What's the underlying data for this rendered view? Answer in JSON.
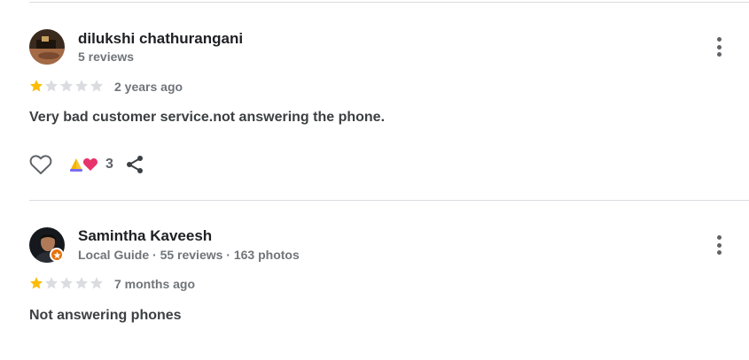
{
  "reviews": [
    {
      "reviewer_name": "dilukshi chathurangani",
      "reviewer_meta": "5 reviews",
      "rating": 1,
      "max_rating": 5,
      "time_ago": "2 years ago",
      "text": "Very bad customer service.not answering the phone.",
      "reaction_count": "3",
      "local_guide": false
    },
    {
      "reviewer_name": "Samintha Kaveesh",
      "reviewer_meta": "Local Guide · 55 reviews · 163 photos",
      "rating": 1,
      "max_rating": 5,
      "time_ago": "7 months ago",
      "text": "Not answering phones",
      "local_guide": true
    }
  ],
  "colors": {
    "star_filled": "#fbbc04",
    "star_empty": "#dadce0",
    "local_guide_badge": "#e8710a",
    "heart_reaction": "#e8336b",
    "pray_reaction": "#f5b400"
  },
  "icons": {
    "like": "heart-outline-icon",
    "share": "share-icon",
    "more": "more-vert-icon",
    "reactions": [
      "pray-emoji-icon",
      "heart-emoji-icon"
    ]
  }
}
